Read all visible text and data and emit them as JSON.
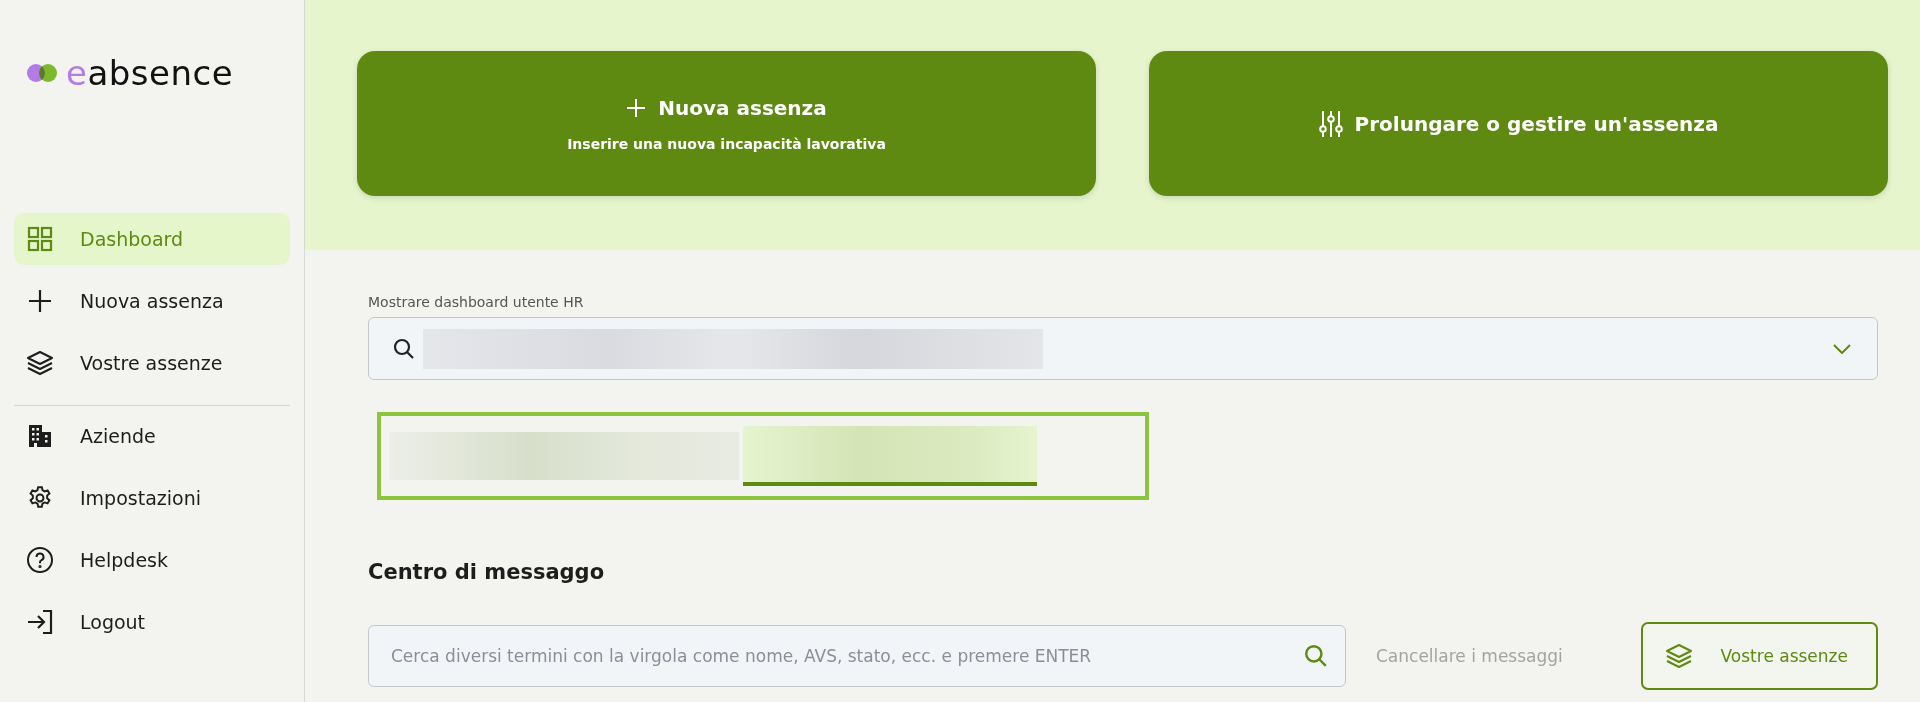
{
  "logo": {
    "text_accent": "e",
    "text": "absence"
  },
  "sidebar": {
    "groups": [
      [
        {
          "label": "Dashboard",
          "selected": true
        },
        {
          "label": "Nuova assenza",
          "selected": false
        },
        {
          "label": "Vostre assenze",
          "selected": false
        }
      ],
      [
        {
          "label": "Aziende",
          "selected": false
        },
        {
          "label": "Impostazioni",
          "selected": false
        },
        {
          "label": "Helpdesk",
          "selected": false
        },
        {
          "label": "Logout",
          "selected": false
        }
      ]
    ]
  },
  "actions": [
    {
      "title": "Nuova assenza",
      "subtitle": "Inserire una nuova incapacità lavorativa"
    },
    {
      "title": "Prolungare o gestire un'assenza"
    }
  ],
  "user_select": {
    "label": "Mostrare dashboard utente HR"
  },
  "message_center": {
    "heading": "Centro di messaggo",
    "search": {
      "placeholder": "Cerca diversi termini con la virgola come nome, AVS, stato, ecc. e premere ENTER"
    },
    "clear": {
      "label": "Cancellare i messaggi",
      "disabled": true
    },
    "button": {
      "label": "Vostre assenze"
    }
  }
}
